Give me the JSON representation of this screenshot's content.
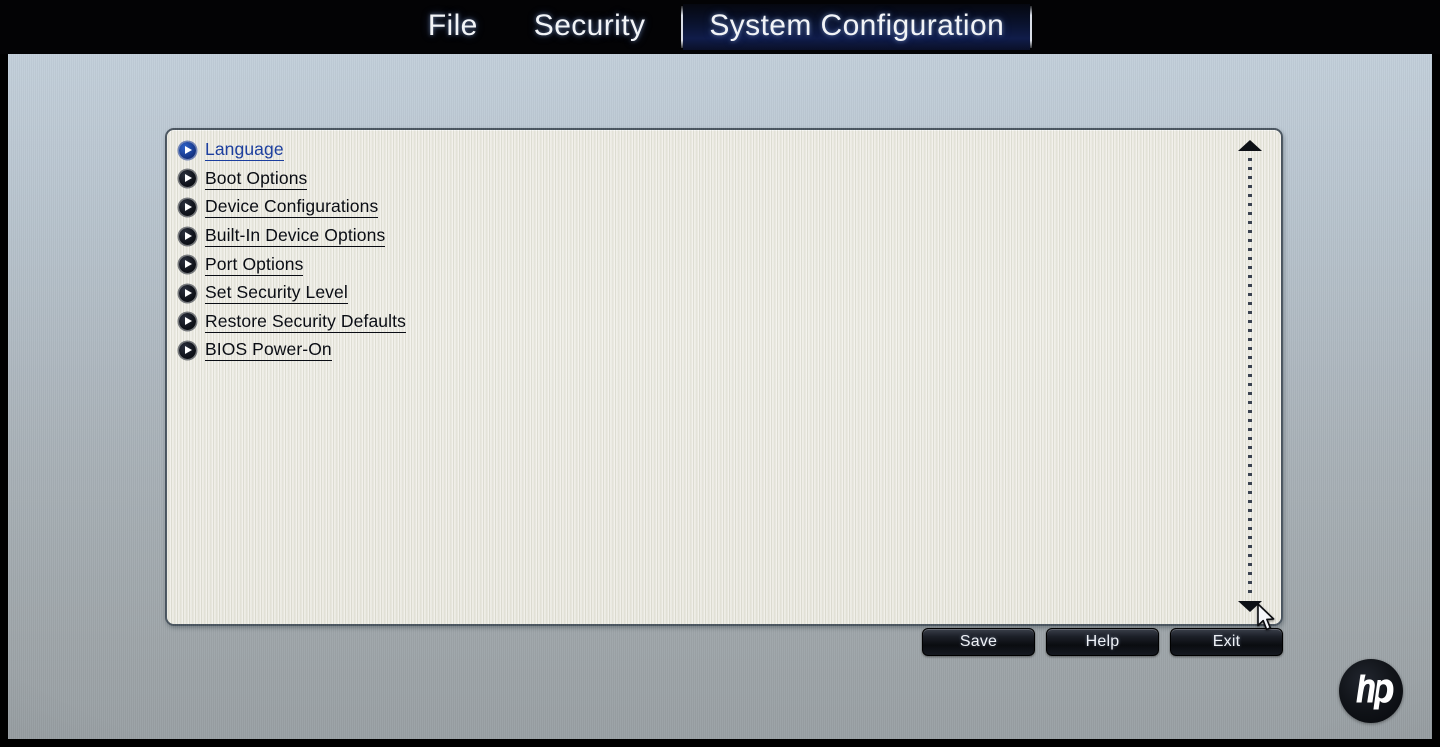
{
  "menubar": {
    "tabs": [
      {
        "label": "File",
        "active": false
      },
      {
        "label": "Security",
        "active": false
      },
      {
        "label": "System Configuration",
        "active": true
      }
    ]
  },
  "panel": {
    "items": [
      {
        "label": "Language",
        "selected": true
      },
      {
        "label": "Boot Options",
        "selected": false
      },
      {
        "label": "Device Configurations",
        "selected": false
      },
      {
        "label": "Built-In Device Options",
        "selected": false
      },
      {
        "label": "Port Options",
        "selected": false
      },
      {
        "label": "Set Security Level",
        "selected": false
      },
      {
        "label": "Restore Security Defaults",
        "selected": false
      },
      {
        "label": "BIOS Power-On",
        "selected": false
      }
    ],
    "scrollbar": {
      "up_arrow_icon": "triangle-up-icon",
      "down_arrow_icon": "triangle-down-icon"
    }
  },
  "buttons": [
    {
      "label": "Save"
    },
    {
      "label": "Help"
    },
    {
      "label": "Exit"
    }
  ],
  "branding": {
    "logo_icon": "hp-logo-icon",
    "logo_text": "hp"
  },
  "cursor": {
    "icon": "mouse-pointer-icon"
  },
  "colors": {
    "menubar_bg": "#030305",
    "active_tab_bg": "#101c4a",
    "desktop_top": "#c2cfda",
    "desktop_bottom": "#99a0a4",
    "panel_bg": "#eceae0",
    "panel_border": "#4a5560",
    "item_text": "#0a0d14",
    "selected_item_text": "#1d3f9e",
    "button_bg": "#0a0c10",
    "button_text": "#eef1f6"
  }
}
